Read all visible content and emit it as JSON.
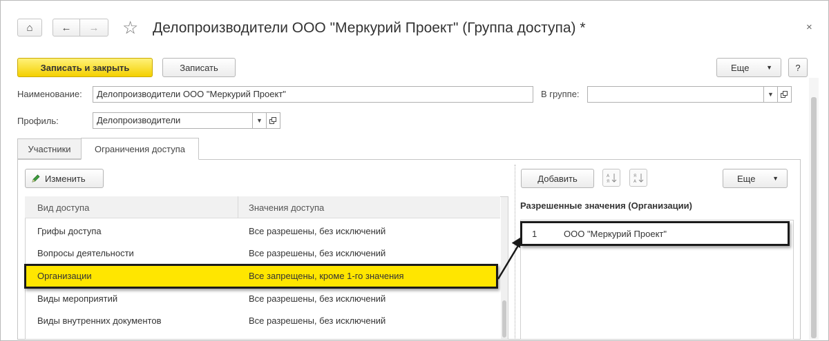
{
  "window": {
    "title": "Делопроизводители ООО \"Меркурий Проект\" (Группа доступа) *",
    "close_glyph": "×"
  },
  "nav": {
    "home_glyph": "⌂",
    "back_glyph": "←",
    "forward_glyph": "→",
    "favorite_glyph": "☆"
  },
  "toolbar": {
    "save_close_label": "Записать и закрыть",
    "save_label": "Записать",
    "more_label": "Еще",
    "help_label": "?"
  },
  "form": {
    "name_label": "Наименование:",
    "name_value": "Делопроизводители ООО \"Меркурий Проект\"",
    "group_label": "В группе:",
    "group_value": "",
    "profile_label": "Профиль:",
    "profile_value": "Делопроизводители"
  },
  "tabs": [
    {
      "label": "Участники",
      "active": false
    },
    {
      "label": "Ограничения доступа",
      "active": true
    }
  ],
  "left_panel": {
    "edit_label": "Изменить",
    "columns": [
      "Вид доступа",
      "Значения доступа"
    ],
    "rows": [
      {
        "kind": "Грифы доступа",
        "value": "Все разрешены, без исключений",
        "selected": false
      },
      {
        "kind": "Вопросы деятельности",
        "value": "Все разрешены, без исключений",
        "selected": false
      },
      {
        "kind": "Организации",
        "value": "Все запрещены, кроме 1-го значения",
        "selected": true
      },
      {
        "kind": "Виды мероприятий",
        "value": "Все разрешены, без исключений",
        "selected": false
      },
      {
        "kind": "Виды внутренних документов",
        "value": "Все разрешены, без исключений",
        "selected": false
      }
    ]
  },
  "right_panel": {
    "add_label": "Добавить",
    "more_label": "Еще",
    "heading": "Разрешенные значения (Организации)",
    "rows": [
      {
        "num": "1",
        "value": "ООО \"Меркурий Проект\""
      }
    ]
  },
  "colors": {
    "primary_button": "#f4d000",
    "selected_row": "#ffe600",
    "highlight_border": "#1a1a1a"
  }
}
